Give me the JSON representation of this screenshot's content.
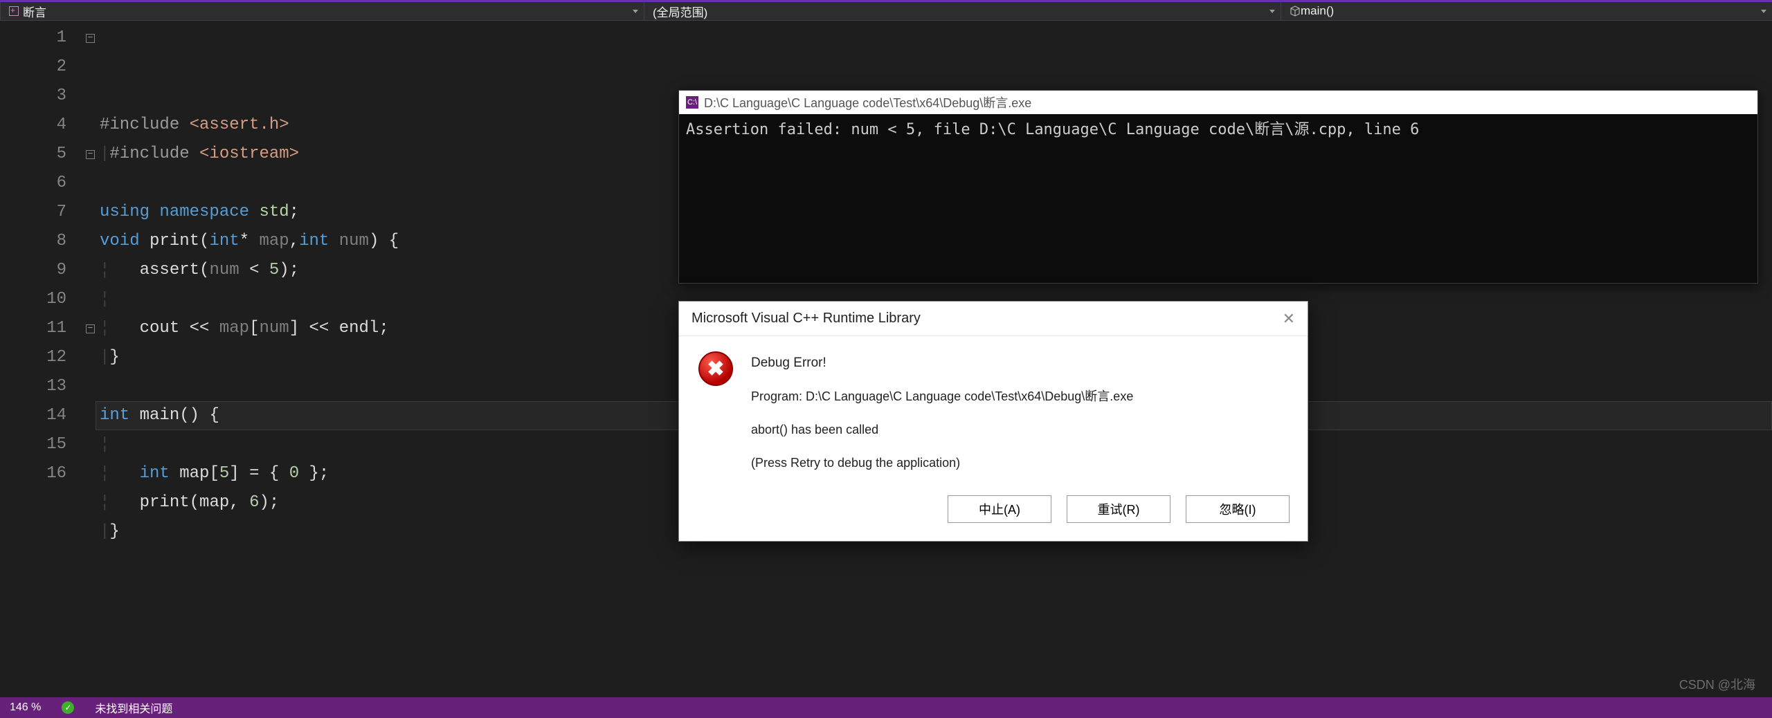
{
  "topbar": {
    "file_tab": "断言",
    "scope": "(全局范围)",
    "function": "main()"
  },
  "gutter": {
    "start": 1,
    "end": 16,
    "folds": {
      "1": true,
      "5": true,
      "11": true
    }
  },
  "code": {
    "lines": [
      {
        "n": 1,
        "html": "<span class='c-pp'>#include</span> <span class='c-str'>&lt;assert.h&gt;</span>"
      },
      {
        "n": 2,
        "html": "<span class='guide'>|</span><span class='c-pp'>#include</span> <span class='c-str'>&lt;iostream&gt;</span>"
      },
      {
        "n": 3,
        "html": ""
      },
      {
        "n": 4,
        "html": "<span class='c-kw'>using</span> <span class='c-kw'>namespace</span> <span class='c-ns'>std</span>;"
      },
      {
        "n": 5,
        "html": "<span class='c-kw'>void</span> <span class='c-func'>print</span>(<span class='c-kw'>int</span>* <span class='c-param'>map</span>,<span class='c-kw'>int</span> <span class='c-param'>num</span>) {"
      },
      {
        "n": 6,
        "html": "<span class='guide'>&#x00A6;</span>   <span class='c-func'>assert</span>(<span class='c-param'>num</span> &lt; <span class='c-num'>5</span>);"
      },
      {
        "n": 7,
        "html": "<span class='guide'>&#x00A6;</span>"
      },
      {
        "n": 8,
        "html": "<span class='guide'>&#x00A6;</span>   <span class='c-id'>cout</span> &lt;&lt; <span class='c-param'>map</span>[<span class='c-param'>num</span>] &lt;&lt; <span class='c-id'>endl</span>;"
      },
      {
        "n": 9,
        "html": "<span class='guide'>|</span>}"
      },
      {
        "n": 10,
        "html": ""
      },
      {
        "n": 11,
        "html": "<span class='c-kw'>int</span> <span class='c-func'>main</span>() {"
      },
      {
        "n": 12,
        "html": "<span class='guide'>&#x00A6;</span>"
      },
      {
        "n": 13,
        "html": "<span class='guide'>&#x00A6;</span>   <span class='c-kw'>int</span> <span class='c-id'>map</span>[<span class='c-num'>5</span>] = { <span class='c-num'>0</span> };"
      },
      {
        "n": 14,
        "html": "<span class='guide'>&#x00A6;</span>   <span class='c-func'>print</span>(<span class='c-id'>map</span>, <span class='c-num'>6</span>);"
      },
      {
        "n": 15,
        "html": "<span class='guide'>|</span>}"
      },
      {
        "n": 16,
        "html": ""
      }
    ],
    "highlight_line": 14
  },
  "console": {
    "icon_text": "C:\\",
    "title": "D:\\C Language\\C Language code\\Test\\x64\\Debug\\断言.exe",
    "output": "Assertion failed: num < 5, file D:\\C Language\\C Language code\\断言\\源.cpp, line 6"
  },
  "dialog": {
    "title": "Microsoft Visual C++ Runtime Library",
    "heading": "Debug Error!",
    "program_line": "Program: D:\\C Language\\C Language code\\Test\\x64\\Debug\\断言.exe",
    "abort_line": "abort() has been called",
    "hint_line": "(Press Retry to debug the application)",
    "buttons": {
      "abort": "中止(A)",
      "retry": "重试(R)",
      "ignore": "忽略(I)"
    }
  },
  "status": {
    "zoom": "146 %",
    "issues": "未找到相关问题"
  },
  "watermark": "CSDN @北海"
}
